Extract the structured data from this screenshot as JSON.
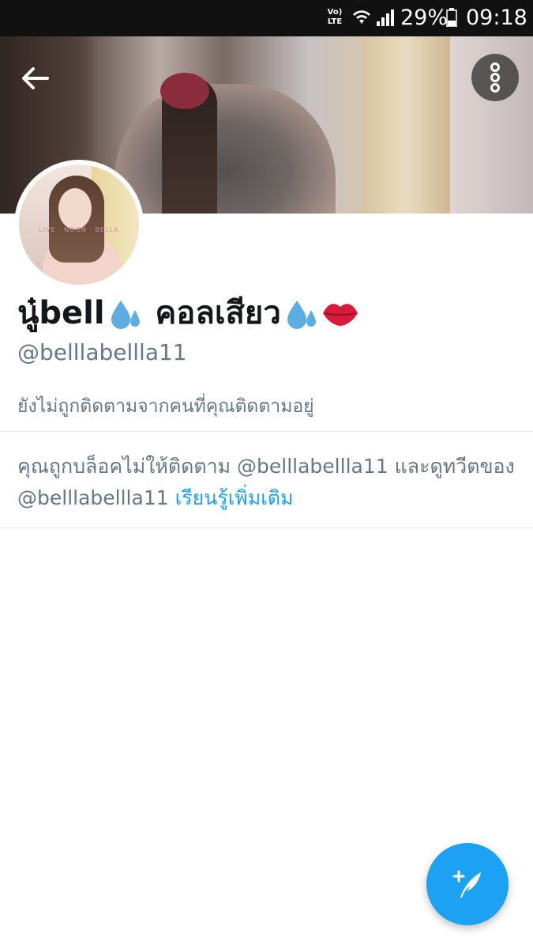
{
  "status_bar": {
    "volte_label": "Vo) LTE",
    "battery_percent": "29%",
    "time": "09:18"
  },
  "header": {
    "back_icon": "arrow-left-icon",
    "more_icon": "more-vertical-icon"
  },
  "profile": {
    "display_name_part1": "นู๋bell",
    "display_name_part2": "คอลเสียว",
    "name_emojis": [
      "sweat-droplets-emoji",
      "sweat-droplets-emoji",
      "kiss-mark-emoji"
    ],
    "handle": "@belllabellla11",
    "follow_status": "ยังไม่ถูกติดตามจากคนที่คุณติดตามอยู่",
    "avatar_watermark": "LIVE · NOON · BELLA"
  },
  "blocked_notice": {
    "text": "คุณถูกบล็อคไม่ให้ติดตาม @belllabellla11 และดูทวีตของ @belllabellla11",
    "learn_more": "เรียนรู้เพิ่มเติม"
  },
  "compose_fab": {
    "icon": "compose-tweet-icon"
  },
  "colors": {
    "accent": "#1da1f2",
    "secondary_text": "#657786",
    "primary_text": "#14171a",
    "divider": "#e1e8ed"
  }
}
